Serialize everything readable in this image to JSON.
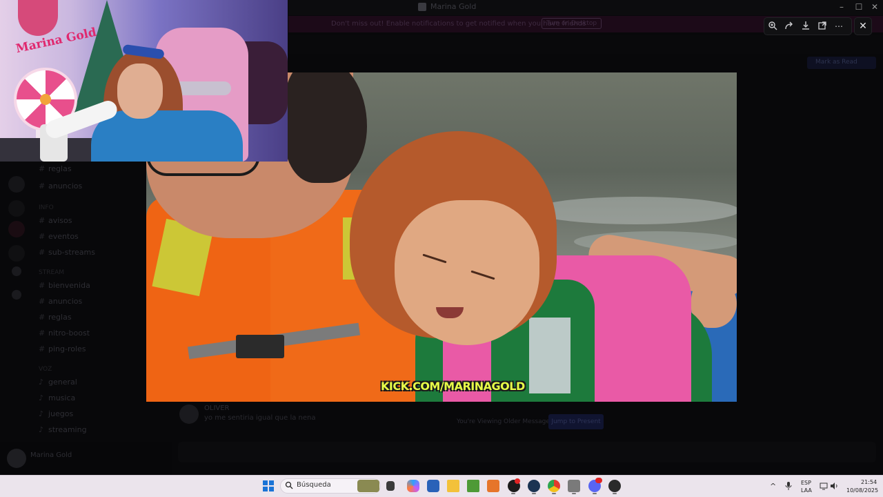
{
  "background_app": {
    "window_title": "Marina Gold",
    "banner_text": "Don't miss out! Enable notifications to get notified when you have friends",
    "banner_button": "Turn on Desktop",
    "pill_label": "Mark as Read",
    "sections": [
      {
        "head": "",
        "channels": [
          "reglas",
          "anuncios"
        ]
      },
      {
        "head": "INFO",
        "channels": [
          "avisos",
          "eventos",
          "sub-streams"
        ]
      },
      {
        "head": "STREAM",
        "channels": [
          "bienvenida",
          "anuncios",
          "reglas",
          "nitro-boost",
          "ping-roles"
        ]
      },
      {
        "head": "VOZ",
        "channels": [
          "general",
          "musica",
          "juegos",
          "streaming"
        ]
      }
    ],
    "user_panel_name": "Marina Gold",
    "chat_author": "OLIVER",
    "chat_message": "yo me sentiria igual que la nena",
    "viewing_older": "You're Viewing Older Messages",
    "jump_button": "Jump to Present"
  },
  "webcam": {
    "logo_text": "Marina Gold"
  },
  "video": {
    "watermark": "KICK.COM/MARINAGOLD"
  },
  "viewer_toolbar": {
    "zoom_icon": "zoom-in-icon",
    "share_icon": "share-icon",
    "download_icon": "download-icon",
    "open_icon": "open-external-icon",
    "more_icon": "more-icon",
    "close_icon": "close-icon"
  },
  "taskbar": {
    "search_placeholder": "Búsqueda",
    "apps": [
      "file-explorer",
      "copilot",
      "store",
      "folder",
      "minecraft",
      "app-a",
      "chrome-red",
      "steam",
      "chrome",
      "game",
      "discord",
      "obs"
    ],
    "language": "ESP",
    "layout": "LAA",
    "time": "21:54",
    "date": "10/08/2025"
  },
  "colors": {
    "taskbar_bg": "#ebe4ec",
    "watermark": "#e8ff48",
    "kick_orange": "#ef6414",
    "vest_pink": "#e95aa6"
  }
}
